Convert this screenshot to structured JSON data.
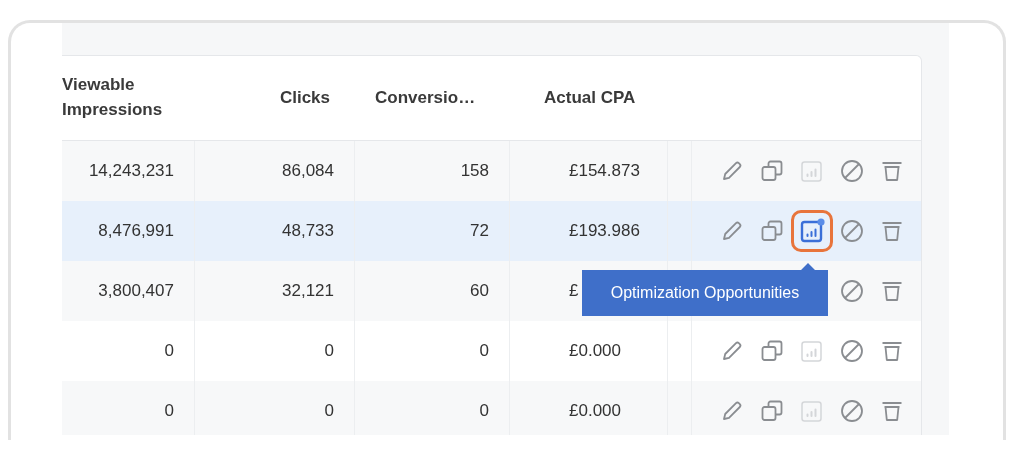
{
  "table": {
    "columns": [
      {
        "label": "Viewable Impressions"
      },
      {
        "label": "Clicks"
      },
      {
        "label": "Conversio…"
      },
      {
        "label": "Actual CPA"
      }
    ],
    "rows": [
      {
        "selected": false,
        "cells": [
          "14,243,231",
          "86,084",
          "158",
          "£154.873"
        ],
        "actions": [
          {
            "kind": "edit"
          },
          {
            "kind": "copy"
          },
          {
            "kind": "optimize",
            "active": false
          },
          {
            "kind": "block"
          },
          {
            "kind": "delete"
          }
        ]
      },
      {
        "selected": true,
        "cells": [
          "8,476,991",
          "48,733",
          "72",
          "£193.986"
        ],
        "actions": [
          {
            "kind": "edit"
          },
          {
            "kind": "copy"
          },
          {
            "kind": "optimize",
            "active": true
          },
          {
            "kind": "block"
          },
          {
            "kind": "delete"
          }
        ]
      },
      {
        "selected": false,
        "cells": [
          "3,800,407",
          "32,121",
          "60",
          "£"
        ],
        "actions": [
          {
            "kind": "block"
          },
          {
            "kind": "delete"
          }
        ]
      },
      {
        "selected": false,
        "cells": [
          "0",
          "0",
          "0",
          "£0.000"
        ],
        "actions": [
          {
            "kind": "edit"
          },
          {
            "kind": "copy"
          },
          {
            "kind": "optimize",
            "active": false
          },
          {
            "kind": "block"
          },
          {
            "kind": "delete"
          }
        ]
      },
      {
        "selected": false,
        "cells": [
          "0",
          "0",
          "0",
          "£0.000"
        ],
        "actions": [
          {
            "kind": "edit"
          },
          {
            "kind": "copy"
          },
          {
            "kind": "optimize",
            "active": false
          },
          {
            "kind": "block"
          },
          {
            "kind": "delete"
          }
        ]
      }
    ]
  },
  "tooltip": {
    "text": "Optimization Opportunities"
  }
}
